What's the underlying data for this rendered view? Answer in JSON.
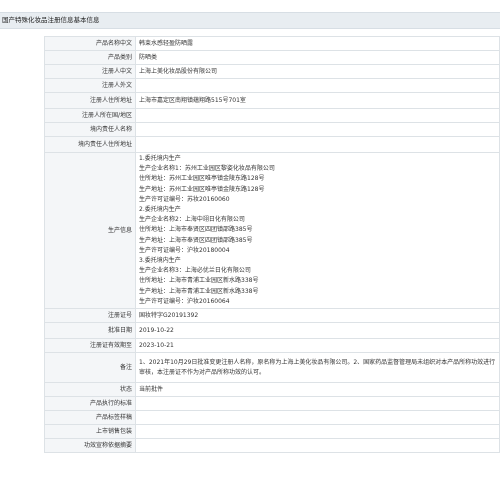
{
  "header": {
    "title": "国产特殊化妆品注册信息基本信息"
  },
  "rows": {
    "product_name_cn": {
      "label": "产品名称中文",
      "value": "韩束水感轻盈防晒露"
    },
    "product_category": {
      "label": "产品类别",
      "value": "防晒类"
    },
    "registrant_cn": {
      "label": "注册人中文",
      "value": "上海上美化妆品股份有限公司"
    },
    "registrant_en": {
      "label": "注册人外文",
      "value": ""
    },
    "registrant_address": {
      "label": "注册人住所地址",
      "value": "上海市嘉定区南翔镇蕴翔路515号701室"
    },
    "registrant_country": {
      "label": "注册人所在国/地区",
      "value": ""
    },
    "domestic_agent": {
      "label": "境内责任人名称",
      "value": ""
    },
    "domestic_agent_address": {
      "label": "境内责任人住所地址",
      "value": ""
    },
    "production_info": {
      "label": "生产信息",
      "lines": [
        "1.委托境内生产",
        "生产企业名称1：苏州工业园区黎姿化妆品有限公司",
        "住所地址：苏州工业园区唯亭镇金陵东路128号",
        "生产地址：苏州工业园区唯亭镇金陵东路128号",
        "生产许可证编号：苏妆20160060",
        "2.委托境内生产",
        "生产企业名称2：上海中翊日化有限公司",
        "住所地址：上海市奉贤区四团镇邵路385号",
        "生产地址：上海市奉贤区四团镇邵路385号",
        "生产许可证编号：沪妆20180004",
        "3.委托境内生产",
        "生产企业名称3：上海必优兰日化有限公司",
        "住所地址：上海市青浦工业园区新水路338号",
        "生产地址：上海市青浦工业园区新水路338号",
        "生产许可证编号：沪妆20160064"
      ]
    },
    "registration_no": {
      "label": "注册证号",
      "value": "国妆特字G20191392"
    },
    "approval_date": {
      "label": "批准日期",
      "value": "2019-10-22"
    },
    "expiry_date": {
      "label": "注册证有效期至",
      "value": "2023-10-21"
    },
    "remarks": {
      "label": "备注",
      "value": "1、2021年10月29日批准变更注册人名称，原名称为上海上美化妆品有限公司。2、国家药品监督管理局未组织对本产品所称功效进行审核，本注册证不作为对产品所称功效的认可。"
    },
    "status": {
      "label": "状态",
      "value": "当前批件"
    },
    "exec_standard": {
      "label": "产品执行的标准",
      "value": ""
    },
    "label_sample": {
      "label": "产品标签样稿",
      "value": ""
    },
    "sales_package": {
      "label": "上市销售包装",
      "value": ""
    },
    "efficacy_summary": {
      "label": "功效宣称依据摘要",
      "value": ""
    }
  }
}
